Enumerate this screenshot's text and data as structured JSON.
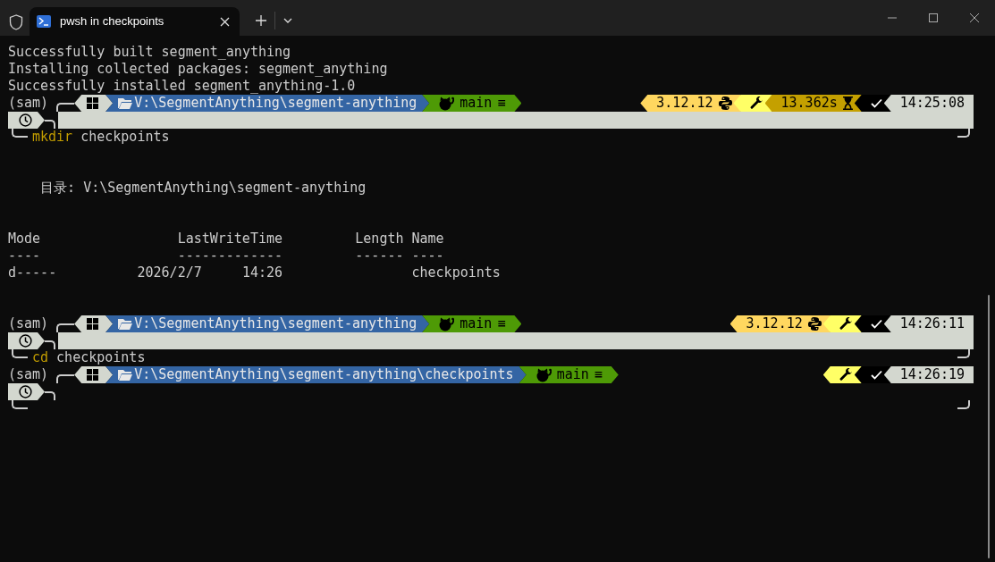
{
  "window": {
    "tab": {
      "title": "pwsh in checkpoints"
    }
  },
  "terminal": {
    "lines": [
      {
        "kind": "output",
        "text": "Successfully built segment_anything"
      },
      {
        "kind": "output",
        "text": "Installing collected packages: segment_anything"
      },
      {
        "kind": "output",
        "text": "Successfully installed segment_anything-1.0"
      },
      {
        "kind": "prompt",
        "env": "(sam)",
        "path": "V:\\SegmentAnything\\segment-anything",
        "branch": "main",
        "branch_status": "≡",
        "right_segments": [
          {
            "kind": "python",
            "text": "3.12.12"
          },
          {
            "kind": "tool"
          },
          {
            "kind": "duration",
            "text": "13.362s"
          },
          {
            "kind": "status"
          },
          {
            "kind": "time",
            "text": "14:25:08"
          }
        ],
        "filled": true,
        "command": {
          "name": "mkdir",
          "args": "checkpoints"
        }
      },
      {
        "kind": "blank"
      },
      {
        "kind": "blank"
      },
      {
        "kind": "output",
        "text": "    目录: V:\\SegmentAnything\\segment-anything"
      },
      {
        "kind": "blank"
      },
      {
        "kind": "blank"
      },
      {
        "kind": "table",
        "columns": [
          {
            "label": "Mode",
            "rule": "----"
          },
          {
            "label": "LastWriteTime",
            "rule": "-------------"
          },
          {
            "label": "Length",
            "rule": "------"
          },
          {
            "label": "Name",
            "rule": "----"
          }
        ],
        "rows": [
          {
            "mode": "d-----",
            "last_write_time": "2026/2/7     14:26",
            "name": "checkpoints"
          }
        ]
      },
      {
        "kind": "blank"
      },
      {
        "kind": "blank"
      },
      {
        "kind": "prompt",
        "env": "(sam)",
        "path": "V:\\SegmentAnything\\segment-anything",
        "branch": "main",
        "branch_status": "≡",
        "right_segments": [
          {
            "kind": "python",
            "text": "3.12.12"
          },
          {
            "kind": "tool"
          },
          {
            "kind": "status"
          },
          {
            "kind": "time",
            "text": "14:26:11"
          }
        ],
        "filled": true,
        "command": {
          "name": "cd",
          "args": "checkpoints"
        }
      },
      {
        "kind": "prompt",
        "env": "(sam)",
        "path": "V:\\SegmentAnything\\segment-anything\\checkpoints",
        "branch": "main",
        "branch_status": "≡",
        "right_segments": [
          {
            "kind": "tool"
          },
          {
            "kind": "status"
          },
          {
            "kind": "time",
            "text": "14:26:19"
          }
        ],
        "filled": false
      }
    ]
  }
}
